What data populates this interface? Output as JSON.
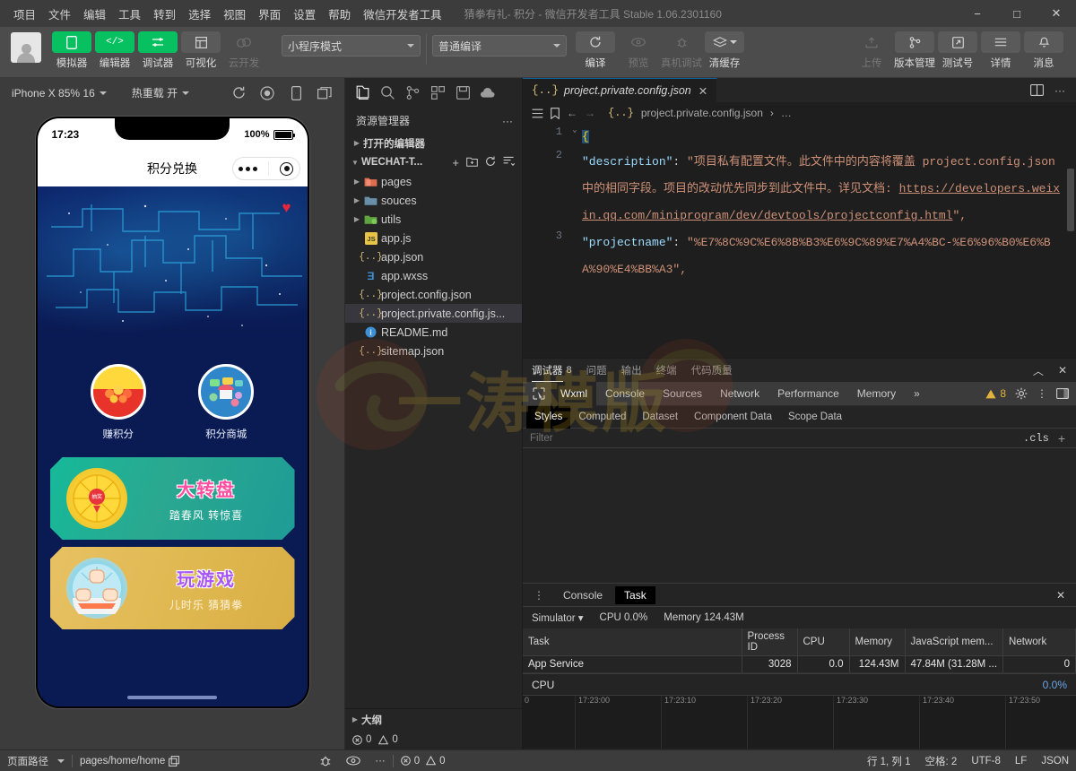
{
  "window": {
    "title": "猜拳有礼- 积分 - 微信开发者工具 Stable 1.06.2301160",
    "minimize": "−",
    "maximize": "□",
    "close": "✕"
  },
  "menubar": {
    "items": [
      "项目",
      "文件",
      "编辑",
      "工具",
      "转到",
      "选择",
      "视图",
      "界面",
      "设置",
      "帮助",
      "微信开发者工具"
    ]
  },
  "toolbar": {
    "left_buttons": [
      {
        "label": "模拟器",
        "icon": "phone-icon",
        "state": "active"
      },
      {
        "label": "编辑器",
        "icon": "code-icon",
        "state": "active"
      },
      {
        "label": "调试器",
        "icon": "debug-icon",
        "state": "active"
      },
      {
        "label": "可视化",
        "icon": "layout-icon",
        "state": "normal"
      },
      {
        "label": "云开发",
        "icon": "cloud-icon",
        "state": "disabled"
      }
    ],
    "mode_select": "小程序模式",
    "compile_select": "普通编译",
    "center_buttons": [
      {
        "label": "编译",
        "icon": "refresh-icon",
        "state": "normal"
      },
      {
        "label": "预览",
        "icon": "eye-icon",
        "state": "disabled"
      },
      {
        "label": "真机调试",
        "icon": "bug-icon",
        "state": "disabled"
      },
      {
        "label": "清缓存",
        "icon": "stack-icon",
        "state": "normal"
      }
    ],
    "right_buttons": [
      {
        "label": "上传",
        "icon": "upload-icon",
        "state": "disabled"
      },
      {
        "label": "版本管理",
        "icon": "branch-icon",
        "state": "normal"
      },
      {
        "label": "测试号",
        "icon": "external-icon",
        "state": "normal"
      },
      {
        "label": "详情",
        "icon": "menu-icon",
        "state": "normal"
      },
      {
        "label": "消息",
        "icon": "bell-icon",
        "state": "normal"
      }
    ]
  },
  "simulator": {
    "device_select": "iPhone X 85% 16",
    "hotreload_select": "热重载 开",
    "icons": [
      "refresh-icon",
      "record-icon",
      "device-icon",
      "window-icon",
      "grid-icon"
    ],
    "phone": {
      "status_time": "17:23",
      "battery_percent": "100%",
      "page_title": "积分兑换",
      "capsule": {
        "more": "•••",
        "target": "target-icon"
      },
      "hero_heart": "♥",
      "grid_items": [
        {
          "label": "赚积分",
          "icon": "coins-icon"
        },
        {
          "label": "积分商城",
          "icon": "mall-icon"
        }
      ],
      "banners": [
        {
          "title": "大转盘",
          "subtitle": "踏春风 转惊喜",
          "art": "wheel-icon"
        },
        {
          "title": "玩游戏",
          "subtitle": "儿时乐 猜猜拳",
          "art": "hands-icon"
        }
      ]
    }
  },
  "explorer": {
    "activity_icons": [
      "files-icon",
      "search-icon",
      "source-control-icon",
      "extensions-icon",
      "save-icon",
      "cloud-icon"
    ],
    "title": "资源管理器",
    "more": "···",
    "open_editors": "打开的编辑器",
    "project_name": "WECHAT-T...",
    "project_actions": [
      "+",
      "new-folder-icon",
      "refresh-icon",
      "collapse-icon"
    ],
    "files": [
      {
        "name": "pages",
        "type": "folder",
        "icon_color": "#e06c4f",
        "expandable": true,
        "selected": false
      },
      {
        "name": "souces",
        "type": "folder",
        "icon_color": "#6a8fa8",
        "expandable": true,
        "selected": false
      },
      {
        "name": "utils",
        "type": "folder",
        "icon_color": "#5ea53f",
        "expandable": true,
        "selected": false
      },
      {
        "name": "app.js",
        "type": "js",
        "icon_color": "#e8c547",
        "expandable": false,
        "selected": false
      },
      {
        "name": "app.json",
        "type": "json",
        "icon_color": "#d7ba7d",
        "expandable": false,
        "selected": false
      },
      {
        "name": "app.wxss",
        "type": "wxss",
        "icon_color": "#3d8fd6",
        "expandable": false,
        "selected": false
      },
      {
        "name": "project.config.json",
        "type": "json",
        "icon_color": "#d7ba7d",
        "expandable": false,
        "selected": false
      },
      {
        "name": "project.private.config.js...",
        "type": "json",
        "icon_color": "#d7ba7d",
        "expandable": false,
        "selected": true
      },
      {
        "name": "README.md",
        "type": "md",
        "icon_color": "#3d8fd6",
        "expandable": false,
        "selected": false
      },
      {
        "name": "sitemap.json",
        "type": "json",
        "icon_color": "#d7ba7d",
        "expandable": false,
        "selected": false
      }
    ],
    "outline": "大纲",
    "problems": {
      "errors": "0",
      "warnings": "0"
    }
  },
  "editor": {
    "tab": {
      "label": "project.private.config.json",
      "icon": "json-icon",
      "close": "✕"
    },
    "tab_actions": [
      "split-editor-icon",
      "more-icon"
    ],
    "breadcrumb_icons": [
      "outline-icon",
      "bookmark-icon",
      "back-icon",
      "forward-icon"
    ],
    "breadcrumb": "project.private.config.json",
    "breadcrumb_more": "…",
    "code": {
      "line1_num": "1",
      "line1_text": "{",
      "line2_num": "2",
      "line2_key": "\"description\"",
      "line2_value": "\"项目私有配置文件。此文件中的内容将覆盖 project.config.json 中的相同字段。项目的改动优先同步到此文件中。详见文档: ",
      "line2_link": "https://developers.weixin.qq.com/miniprogram/dev/devtools/projectconfig.html",
      "line2_tail": "\",",
      "line3_num": "3",
      "line3_key": "\"projectname\"",
      "line3_value": "\"%E7%8C%9C%E6%8B%B3%E6%9C%89%E7%A4%BC-%E6%96%B0%E6%BA%90%E4%BB%A3\","
    }
  },
  "debugger": {
    "panel_tabs": [
      {
        "label": "调试器",
        "badge": "8",
        "active": true
      },
      {
        "label": "问题",
        "badge": "",
        "active": false
      },
      {
        "label": "输出",
        "badge": "",
        "active": false
      },
      {
        "label": "终端",
        "badge": "",
        "active": false
      },
      {
        "label": "代码质量",
        "badge": "",
        "active": false
      }
    ],
    "panel_actions": [
      "collapse-icon",
      "close-icon"
    ],
    "devtools_tabs": [
      {
        "label": "Wxml",
        "active": true
      },
      {
        "label": "Console",
        "active": false
      },
      {
        "label": "Sources",
        "active": false
      },
      {
        "label": "Network",
        "active": false
      },
      {
        "label": "Performance",
        "active": false
      },
      {
        "label": "Memory",
        "active": false
      }
    ],
    "devtools_overflow": "»",
    "warning_count": "8",
    "devtools_right_icons": [
      "inspect-icon",
      "gear-icon",
      "kebab-icon",
      "dock-icon"
    ],
    "style_tabs": [
      {
        "label": "Styles",
        "active": true
      },
      {
        "label": "Computed",
        "active": false
      },
      {
        "label": "Dataset",
        "active": false
      },
      {
        "label": "Component Data",
        "active": false
      },
      {
        "label": "Scope Data",
        "active": false
      }
    ],
    "filter_placeholder": "Filter",
    "cls_button": ".cls",
    "add_button": "+"
  },
  "task": {
    "tabs": [
      {
        "label": "Console",
        "active": false
      },
      {
        "label": "Task",
        "active": true
      }
    ],
    "close": "✕",
    "menu_icon": "kebab-icon",
    "target_select": "Simulator",
    "cpu_summary": "CPU 0.0%",
    "memory_summary": "Memory 124.43M",
    "columns": [
      "Task",
      "Process ID",
      "CPU",
      "Memory",
      "JavaScript mem...",
      "Network"
    ],
    "rows": [
      {
        "task": "App Service",
        "process_id": "3028",
        "cpu": "0.0",
        "memory": "124.43M",
        "js_memory": "47.84M (31.28M ...",
        "network": "0"
      }
    ],
    "cpu_chart": {
      "label": "CPU",
      "value": "0.0%",
      "ticks": [
        "0",
        "17:23:00",
        "17:23:10",
        "17:23:20",
        "17:23:30",
        "17:23:40",
        "17:23:50"
      ]
    }
  },
  "statusbar": {
    "page_path_label": "页面路径",
    "page_path_value": "pages/home/home",
    "copy_icon": "copy-icon",
    "icons": [
      "bug-icon",
      "eye-icon",
      "more-icon"
    ],
    "errors": "0",
    "warnings": "0",
    "line_col": "行 1, 列 1",
    "indent": "空格: 2",
    "encoding": "UTF-8",
    "eol": "LF",
    "language": "JSON"
  },
  "watermark": {
    "text": "一涛模版"
  }
}
